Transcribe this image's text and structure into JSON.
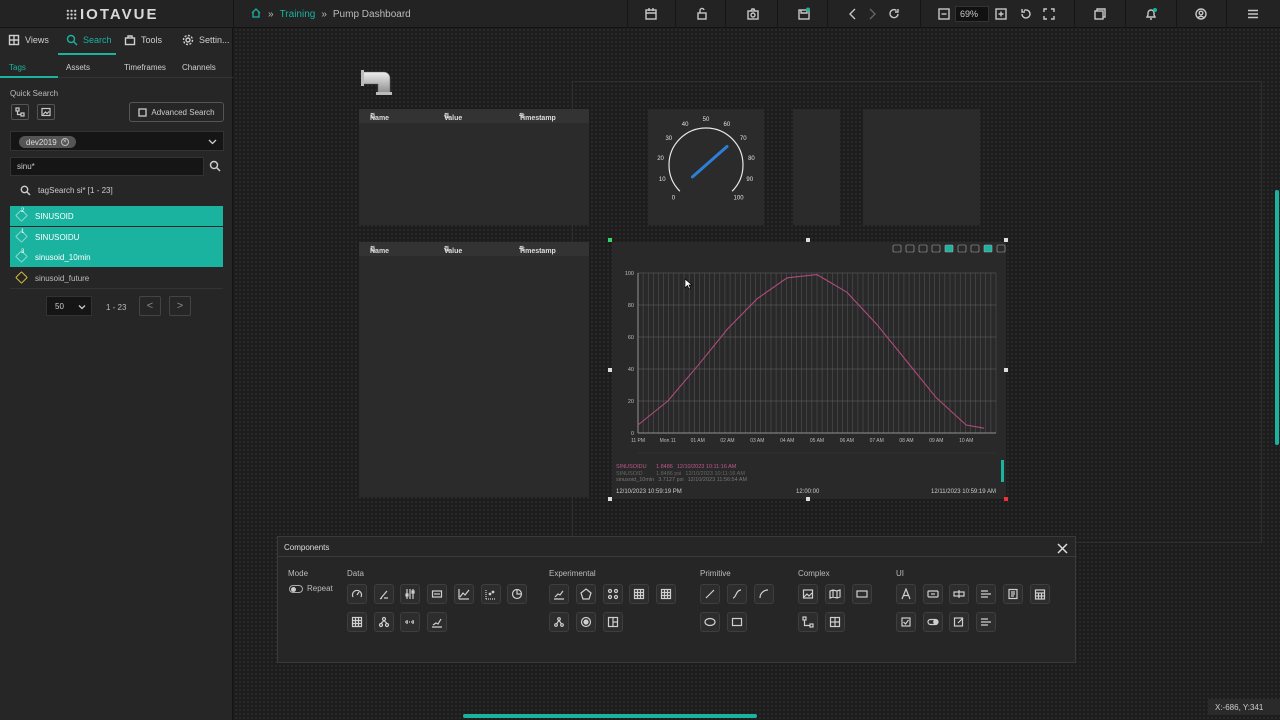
{
  "app": {
    "logo": "IOTAVUE"
  },
  "breadcrumb": {
    "parent": "Training",
    "current": "Pump Dashboard"
  },
  "toolbar": {
    "zoom": "69%"
  },
  "sidebar": {
    "tabs": [
      {
        "label": "Views",
        "icon": "grid-icon"
      },
      {
        "label": "Search",
        "icon": "search-icon"
      },
      {
        "label": "Tools",
        "icon": "toolbox-icon"
      },
      {
        "label": "Settin...",
        "icon": "gear-icon"
      }
    ],
    "subtabs": [
      "Tags",
      "Assets",
      "Timeframes",
      "Channels"
    ],
    "quick_search_label": "Quick Search",
    "advanced_search": "Advanced Search",
    "filter_chip": "dev2019",
    "search_value": "sinu*",
    "tag_search_summary": "tagSearch si* [1 - 23]",
    "results": [
      {
        "name": "SINUSOID",
        "badge": "2",
        "selected": true
      },
      {
        "name": "SINUSOIDU",
        "badge": "1",
        "selected": true
      },
      {
        "name": "sinusoid_10min",
        "badge": "3",
        "selected": true
      },
      {
        "name": "sinusoid_future",
        "badge": "",
        "selected": false
      }
    ],
    "page_size": "50",
    "page_range": "1 - 23",
    "prev": "<",
    "next": ">"
  },
  "tables": {
    "col_name": "Name",
    "col_value": "Value",
    "col_timestamp": "Timestamp"
  },
  "gauge": {
    "ticks": [
      "0",
      "10",
      "20",
      "30",
      "40",
      "50",
      "60",
      "70",
      "80",
      "90",
      "100"
    ],
    "value": 68
  },
  "chart_data": {
    "type": "line",
    "y_ticks": [
      "100",
      "80",
      "60",
      "40",
      "20",
      "0"
    ],
    "ylim": [
      0,
      100
    ],
    "x_ticks": [
      "11 PM",
      "Mon 11",
      "01 AM",
      "02 AM",
      "03 AM",
      "04 AM",
      "05 AM",
      "06 AM",
      "07 AM",
      "08 AM",
      "09 AM",
      "10 AM"
    ],
    "series": [
      {
        "name": "SINUSOIDU",
        "color": "#b04a7e",
        "x": [
          0,
          1,
          2,
          3,
          4,
          5,
          6,
          7,
          8,
          9,
          10,
          11,
          11.6
        ],
        "values": [
          5,
          20,
          42,
          65,
          84,
          97,
          99,
          88,
          68,
          45,
          22,
          5,
          3
        ]
      }
    ],
    "legend": [
      {
        "name": "SINUSOIDU",
        "value": "1.8486",
        "time": "12/10/2023 10:11:16 AM",
        "color": "#c0568c"
      },
      {
        "name": "SINUSOID",
        "value": "1.8486 psi",
        "time": "12/10/2023 10:11:16 AM",
        "color": "#6a6a6a"
      },
      {
        "name": "sinusoid_10min",
        "value": "3.7127 psi",
        "time": "12/10/2023 11:56:54 AM",
        "color": "#6a6a6a"
      }
    ],
    "range_start": "12/10/2023 10:59:19 PM",
    "range_mid": "12:00:00",
    "range_end": "12/11/2023 10:59:19 AM"
  },
  "components": {
    "title": "Components",
    "mode_label": "Mode",
    "repeat_label": "Repeat",
    "groups": [
      "Data",
      "Experimental",
      "Primitive",
      "Complex",
      "UI"
    ]
  },
  "status": {
    "coords": "X:-686, Y:341"
  }
}
